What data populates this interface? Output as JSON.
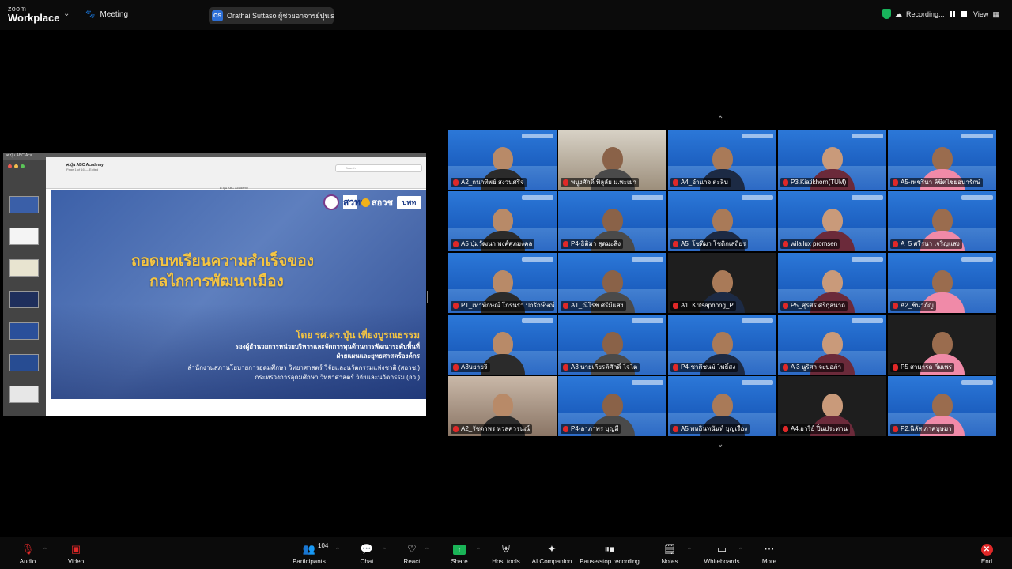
{
  "app": {
    "brand_line1": "zoom",
    "brand_line2": "Workplace",
    "meeting_label": "Meeting"
  },
  "speaker_pill": {
    "initials": "OS",
    "text": "Orathai Suttaso  ผู้ช่วยอาจารย์ปุ่น's :"
  },
  "recording": {
    "label": "Recording..."
  },
  "view_label": "View",
  "shared": {
    "window_title": "ศ.ปุ่น ABC Aca...",
    "file_name": "ศ.ปุ่น ABC Academy",
    "file_sub": "Page 1 of 16 — Edited",
    "search_placeholder": "Search",
    "tab_label": "ศ.ปุ่น ABC Academy",
    "logos": {
      "logo2": "สวทช",
      "logo3": "สอวช",
      "logo4": "บพท"
    },
    "title_line1": "ถอดบทเรียนความสำเร็จของ",
    "title_line2": "กลไกการพัฒนาเมือง",
    "byline": "โดย รศ.ดร.ปุ่น เที่ยงบูรณธรรม",
    "role_line1": "รองผู้อำนวยการหน่วยบริหารและจัดการทุนด้านการพัฒนาระดับพื้นที่",
    "role_line2": "ฝ่ายแผนและยุทธศาสตร์องค์กร",
    "org_line1": "สำนักงานสภานโยบายการอุดมศึกษา วิทยาศาสตร์ วิจัยและนวัตกรรมแห่งชาติ (สอวช.)",
    "org_line2": "กระทรวงการอุดมศึกษา วิทยาศาสตร์ วิจัยและนวัตกรรม (อว.)"
  },
  "gallery": {
    "participants": [
      "A2_กนกทิพย์ สงวนศรีจ",
      "พนูงศักดิ์ พิลุลัย ม.พะเยา",
      "A4_อำนาจ ตะลิบ",
      "P3.Kiatikhorn(TUM)",
      "A5-เพชรินา ลิขิตไชยอนารักษ์",
      "A5 ปุ่มวัฒนา พงศ์ศุภมงคล",
      "P4-ธิติมา สุดมะลิง",
      "A5_โชติมา โชติกเสถียร",
      "wilailux promsen",
      "A_5 ศรีรนา เจริญแสง",
      "P1_เทาทักษณ์ โกรนรา ปกรักษ์ษณ์",
      "A1_ณีโรช ศรีมีแสง",
      "A1. Kritsaphong_P",
      "P5_สุรศร ศรีกุลนาถ",
      "A2_ชินาภัญ",
      "A3ษยายจิ",
      "A3 นายเกียรติศักดิ์ โจโต",
      "P4-ชาติชนม์ โพธิ์สง",
      "A 3 นูริศา จะปอภ้า",
      "P5 สามารถ กิ่มเพร",
      "A2_รัชดาพร หวลควรนณ์",
      "P4-อาภาพร บุญมี",
      "A5 พหอินทนันท์ บุญเรือง",
      "A4.อารีย์ ปิ่นประทาน",
      "P2.นิลัส ภาคบุษมา"
    ]
  },
  "toolbar": {
    "audio": "Audio",
    "video": "Video",
    "participants": "Participants",
    "participants_count": "104",
    "chat": "Chat",
    "react": "React",
    "share": "Share",
    "host_tools": "Host tools",
    "ai_companion": "AI Companion",
    "pause_recording": "Pause/stop recording",
    "notes": "Notes",
    "whiteboards": "Whiteboards",
    "more": "More",
    "end": "End"
  },
  "colors": {
    "accent": "#1ab457",
    "end": "#e02828",
    "slide_title": "#f5c542",
    "tile_blue": "#1f63c6"
  }
}
